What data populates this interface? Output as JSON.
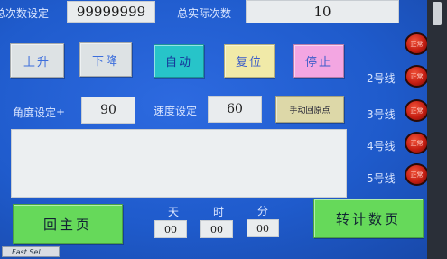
{
  "header": {
    "total_set_label": "总次数设定",
    "total_set_value": "99999999",
    "total_actual_label": "总实际次数",
    "total_actual_value": "10"
  },
  "buttons": {
    "up": "上升",
    "down": "下降",
    "auto": "自动",
    "reset": "复位",
    "stop": "停止",
    "manual_origin": "手动回原点",
    "home": "回主页",
    "count_page": "转计数页"
  },
  "settings": {
    "angle_label": "角度设定±",
    "angle_value": "90",
    "speed_label": "速度设定",
    "speed_value": "60"
  },
  "lines": {
    "line2": "2号线",
    "line3": "3号线",
    "line4": "4号线",
    "line5": "5号线",
    "lamp_text": "正常"
  },
  "timer": {
    "day_label": "天",
    "hour_label": "时",
    "minute_label": "分",
    "day_value": "00",
    "hour_value": "00",
    "minute_value": "00"
  },
  "footer": {
    "fast_sel": "Fast Sel"
  },
  "colors": {
    "screen": "#1f5fd1",
    "auto_button": "#27c4c9",
    "reset_button": "#f1eaa8",
    "stop_button": "#f3a6e2",
    "nav_button": "#66d95a",
    "lamp_red": "#c51e12"
  }
}
